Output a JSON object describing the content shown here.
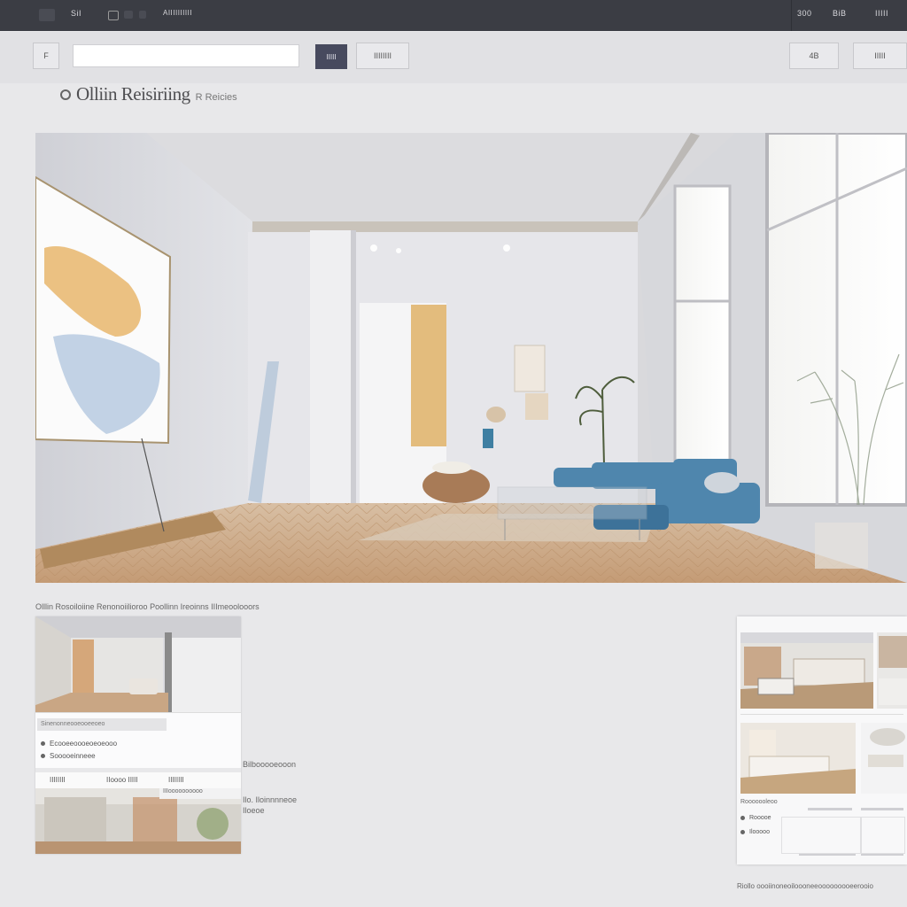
{
  "topbar": {
    "left_label": "SiI",
    "app_name": "AIIIIIIIIII",
    "right_items": [
      "300",
      "BiB",
      "IIIII"
    ]
  },
  "toolbar": {
    "left_button": "F",
    "search_value": "",
    "go_label": "IIIII",
    "secondary_button": "IIIIIIII",
    "right_button_1": "4B",
    "right_button_2": "IIIII"
  },
  "title": {
    "main": "Olliin Reisiriing",
    "sub": "R Reicies"
  },
  "captions": {
    "hero_caption": "Olllin Rosoiloiine Renonoiilioroo Poollinn Ireoinns IIImeoolooors",
    "side_caption_1": "Bilbooooeooon",
    "side_caption_2": "Ilo. Iloinnnneoe",
    "side_caption_3": "Iloeoe",
    "right_footer": "Riollo oooiinoneoiloooneeooooooooeerooio"
  },
  "left_card": {
    "dropdown_header": "Sinenonneooeooeeoeo",
    "options": [
      "Ecooeeoooeoeoeooo",
      "Sooooeinneee"
    ],
    "tabs": [
      "IIIIIIII",
      "IIoooo IIIII",
      "IIIIIIII"
    ],
    "tooltip": "IIIoooooooooo"
  },
  "right_card": {
    "label": "Rooooooleoo",
    "options": [
      "Rooooe",
      "Ilooooo"
    ]
  },
  "colors": {
    "topbar": "#3b3d44",
    "accent_button": "#474a5e",
    "sofa": "#4f86ad",
    "floor": "#c49b75"
  }
}
